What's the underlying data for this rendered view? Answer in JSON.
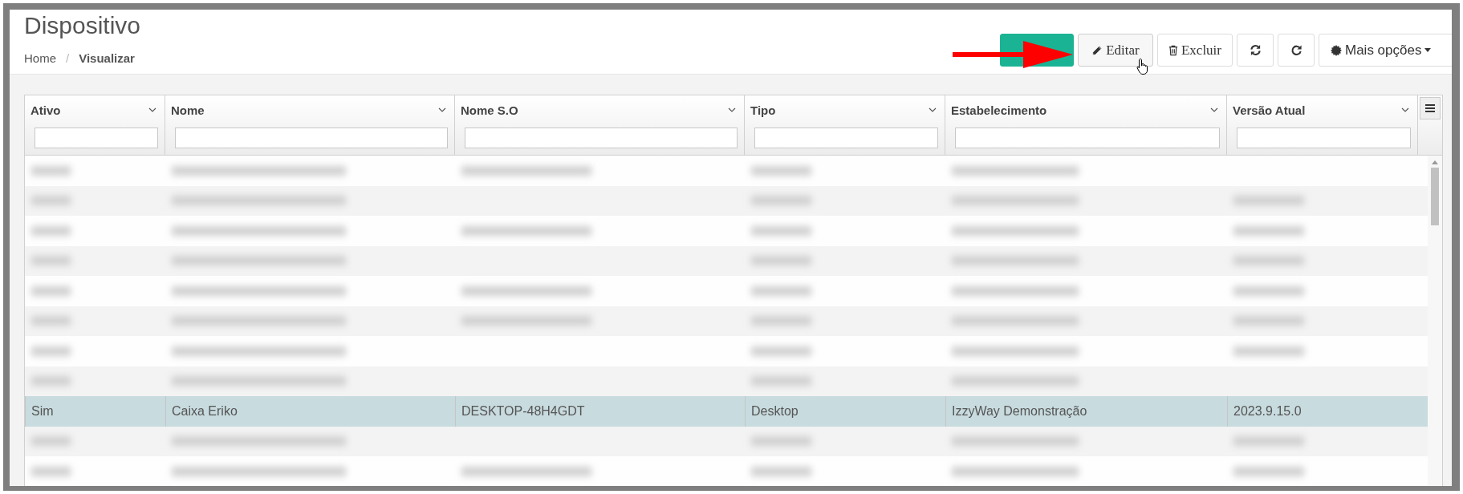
{
  "page": {
    "title": "Dispositivo",
    "breadcrumb_separator": "/",
    "breadcrumb": [
      {
        "label": "Home",
        "current": false
      },
      {
        "label": "Visualizar",
        "current": true
      }
    ]
  },
  "toolbar": [
    {
      "kind": "primary",
      "hovered": false
    },
    {
      "kind": "edit",
      "label": "Editar",
      "hovered": true
    },
    {
      "kind": "delete",
      "label": "Excluir",
      "hovered": false
    },
    {
      "kind": "refresh",
      "hovered": false
    },
    {
      "kind": "reload",
      "hovered": false
    },
    {
      "kind": "more",
      "label": "Mais opções",
      "hovered": false
    }
  ],
  "annotation_arrow": true,
  "table": {
    "columns": [
      {
        "label": "Ativo"
      },
      {
        "label": "Nome"
      },
      {
        "label": "Nome S.O"
      },
      {
        "label": "Tipo"
      },
      {
        "label": "Estabelecimento"
      },
      {
        "label": "Versão Atual"
      }
    ],
    "rows": [
      {
        "kind": "blurred",
        "selected": false,
        "cells": [
          true,
          true,
          true,
          true,
          true,
          false
        ]
      },
      {
        "kind": "blurred",
        "selected": false,
        "cells": [
          true,
          true,
          false,
          true,
          true,
          true
        ]
      },
      {
        "kind": "blurred",
        "selected": false,
        "cells": [
          true,
          true,
          true,
          true,
          true,
          true
        ]
      },
      {
        "kind": "blurred",
        "selected": false,
        "cells": [
          true,
          true,
          false,
          true,
          true,
          true
        ]
      },
      {
        "kind": "blurred",
        "selected": false,
        "cells": [
          true,
          true,
          true,
          true,
          true,
          true
        ]
      },
      {
        "kind": "blurred",
        "selected": false,
        "cells": [
          true,
          true,
          true,
          true,
          true,
          true
        ]
      },
      {
        "kind": "blurred",
        "selected": false,
        "cells": [
          true,
          true,
          false,
          true,
          true,
          true
        ]
      },
      {
        "kind": "blurred",
        "selected": false,
        "cells": [
          true,
          true,
          false,
          true,
          true,
          false
        ]
      },
      {
        "kind": "text",
        "selected": true,
        "cells": [
          "Sim",
          "Caixa Eriko",
          "DESKTOP-48H4GDT",
          "Desktop",
          "IzzyWay Demonstração",
          "2023.9.15.0"
        ]
      },
      {
        "kind": "blurred",
        "selected": false,
        "cells": [
          true,
          true,
          false,
          true,
          true,
          true
        ]
      },
      {
        "kind": "blurred",
        "selected": false,
        "cells": [
          true,
          true,
          true,
          true,
          true,
          true
        ]
      }
    ]
  }
}
